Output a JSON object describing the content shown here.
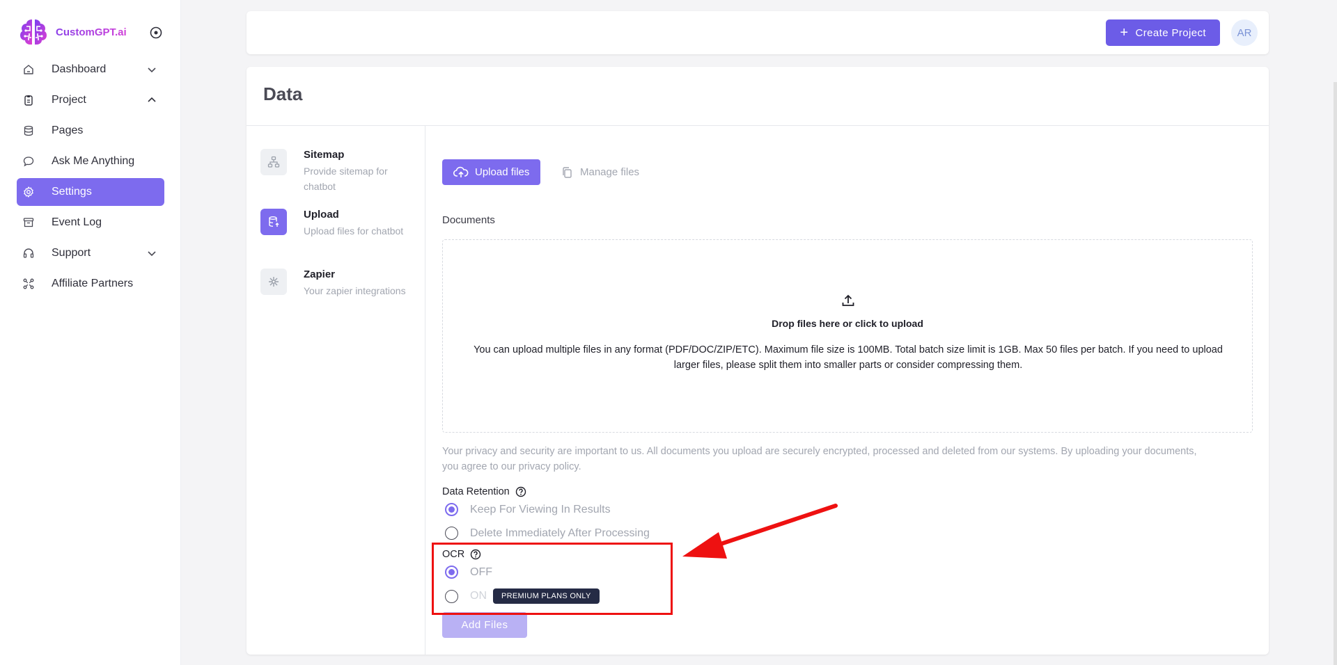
{
  "brand": {
    "name": "CustomGPT.ai"
  },
  "sidebar": {
    "items": [
      {
        "label": "Dashboard",
        "icon": "home-icon",
        "chevron": "down"
      },
      {
        "label": "Project",
        "icon": "clipboard-icon",
        "chevron": "up"
      },
      {
        "label": "Pages",
        "icon": "database-icon"
      },
      {
        "label": "Ask Me Anything",
        "icon": "chat-bubble-icon"
      },
      {
        "label": "Settings",
        "icon": "gear-icon",
        "active": true
      },
      {
        "label": "Event Log",
        "icon": "archive-icon"
      },
      {
        "label": "Support",
        "icon": "headset-icon",
        "chevron": "down"
      },
      {
        "label": "Affiliate Partners",
        "icon": "network-icon"
      }
    ]
  },
  "header": {
    "create_label": "Create Project",
    "avatar_initials": "AR"
  },
  "card": {
    "title": "Data",
    "steps": [
      {
        "title": "Sitemap",
        "desc": "Provide sitemap for chatbot"
      },
      {
        "title": "Upload",
        "desc": "Upload files for chatbot",
        "active": true
      },
      {
        "title": "Zapier",
        "desc": "Your zapier integrations"
      }
    ]
  },
  "upload": {
    "tab_upload": "Upload files",
    "tab_manage": "Manage files",
    "documents_label": "Documents",
    "drop_title": "Drop files here or click to upload",
    "drop_desc": "You can upload multiple files in any format (PDF/DOC/ZIP/ETC). Maximum file size is 100MB. Total batch size limit is 1GB. Max 50 files per batch. If you need to upload larger files, please split them into smaller parts or consider compressing them.",
    "privacy": "Your privacy and security are important to us. All documents you upload are securely encrypted, processed and deleted from our systems. By uploading your documents, you agree to our privacy policy.",
    "retention": {
      "label": "Data Retention",
      "options": [
        {
          "label": "Keep For Viewing In Results",
          "checked": true
        },
        {
          "label": "Delete Immediately After Processing",
          "checked": false
        }
      ]
    },
    "ocr": {
      "label": "OCR",
      "options": [
        {
          "label": "OFF",
          "checked": true
        },
        {
          "label": "ON",
          "checked": false,
          "badge": "PREMIUM PLANS ONLY"
        }
      ]
    },
    "add_files_label": "Add Files"
  },
  "colors": {
    "accent": "#7d6bee",
    "primary_button": "#6c5ce7",
    "annotation": "#ee1111"
  }
}
